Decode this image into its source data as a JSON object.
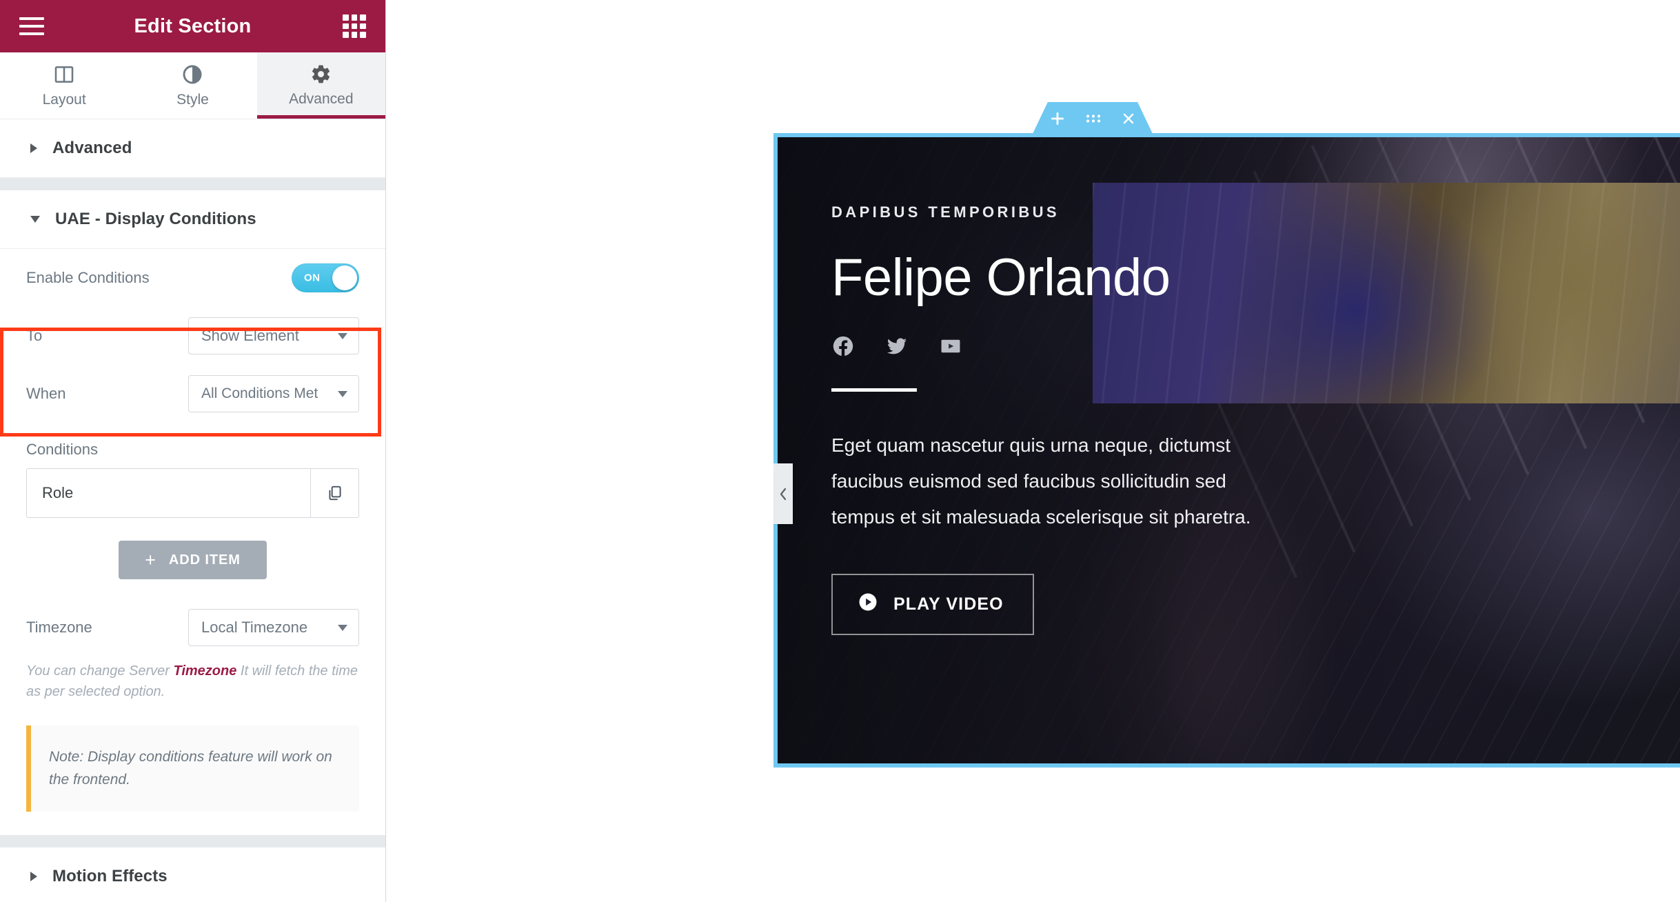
{
  "panel": {
    "header": {
      "title": "Edit Section",
      "menu_icon": "hamburger-icon",
      "apps_icon": "widgets-grid-icon"
    },
    "tabs": [
      {
        "label": "Layout",
        "icon": "columns-layout-icon",
        "active": false
      },
      {
        "label": "Style",
        "icon": "contrast-half-circle-icon",
        "active": false
      },
      {
        "label": "Advanced",
        "icon": "gear-icon",
        "active": true
      }
    ],
    "sections": [
      {
        "title": "Advanced",
        "expanded": false
      },
      {
        "title": "UAE - Display Conditions",
        "expanded": true
      },
      {
        "title": "Motion Effects",
        "expanded": false
      }
    ],
    "display_conditions": {
      "enable_label": "Enable Conditions",
      "enable_state": "ON",
      "to_label": "To",
      "to_value": "Show Element",
      "when_label": "When",
      "when_value": "All Conditions Met",
      "conditions_label": "Conditions",
      "condition_items": [
        {
          "name": "Role",
          "tool_icon": "copy-duplicate-icon"
        }
      ],
      "add_item_label": "ADD ITEM",
      "add_item_plus": "+",
      "timezone_label": "Timezone",
      "timezone_value": "Local Timezone",
      "timezone_help_pre": "You can change Server ",
      "timezone_help_link": "Timezone",
      "timezone_help_post": " It will fetch the time as per selected option.",
      "note_text": "Note: Display conditions feature will work on the frontend."
    },
    "highlight_color": "#fe3b17"
  },
  "canvas": {
    "section_toolbar": {
      "add_icon": "plus-icon",
      "drag_icon": "drag-handle-dots-icon",
      "close_icon": "close-x-icon",
      "color": "#6ec8f1"
    },
    "collapse_handle_icon": "chevron-left-icon",
    "hero": {
      "eyebrow": "DAPIBUS TEMPORIBUS",
      "name": "Felipe Orlando",
      "socials": [
        {
          "name": "facebook-icon"
        },
        {
          "name": "twitter-icon"
        },
        {
          "name": "youtube-icon"
        }
      ],
      "paragraph": "Eget quam nascetur quis urna neque, dictumst faucibus euismod sed faucibus sollicitudin sed tempus et sit malesuada scelerisque sit pharetra.",
      "play_button_label": "PLAY VIDEO",
      "play_icon": "play-circle-icon"
    }
  }
}
